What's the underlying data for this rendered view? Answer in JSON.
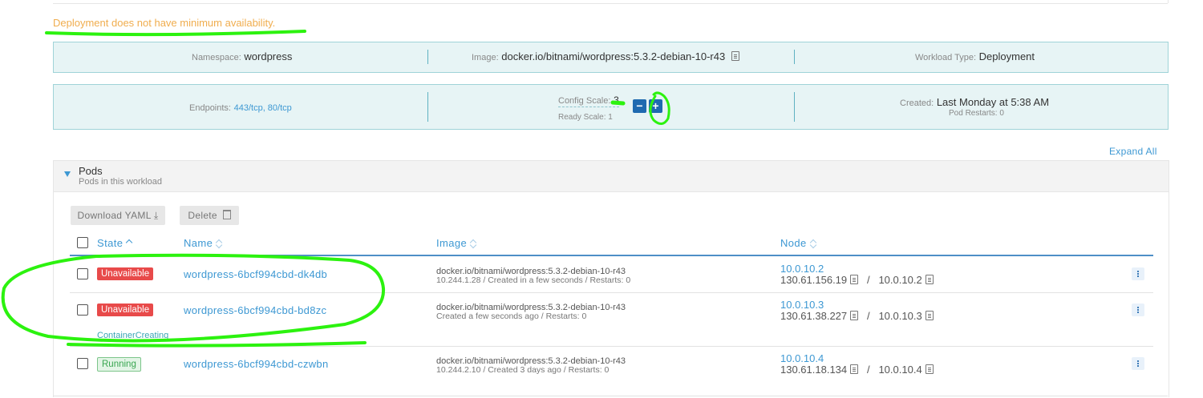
{
  "warning": "Deployment does not have minimum availability.",
  "info_row1": {
    "namespace_label": "Namespace:",
    "namespace_value": "wordpress",
    "image_label": "Image:",
    "image_value": "docker.io/bitnami/wordpress:5.3.2-debian-10-r43",
    "workload_type_label": "Workload Type:",
    "workload_type_value": "Deployment"
  },
  "info_row2": {
    "endpoints_label": "Endpoints:",
    "endpoints_value": "443/tcp, 80/tcp",
    "config_scale_label": "Config Scale:",
    "config_scale_value": "3",
    "ready_scale": "Ready Scale: 1",
    "decrement_label": "−",
    "increment_label": "+",
    "created_label": "Created:",
    "created_value": "Last Monday at 5:38 AM",
    "pod_restarts": "Pod Restarts: 0"
  },
  "expand_all": "Expand All",
  "pods": {
    "title": "Pods",
    "subtitle": "Pods in this workload",
    "download_yaml": "Download YAML",
    "delete": "Delete",
    "columns": {
      "state": "State",
      "name": "Name",
      "image": "Image",
      "node": "Node"
    },
    "rows": [
      {
        "state": "Unavailable",
        "name": "wordpress-6bcf994cbd-dk4db",
        "image": "docker.io/bitnami/wordpress:5.3.2-debian-10-r43",
        "image_detail": "10.244.1.28 / Created in a few seconds / Restarts: 0",
        "node_name": "10.0.10.2",
        "node_ip": "130.61.156.19",
        "node_sep": "/",
        "node_internal": "10.0.10.2",
        "substate": ""
      },
      {
        "state": "Unavailable",
        "name": "wordpress-6bcf994cbd-bd8zc",
        "image": "docker.io/bitnami/wordpress:5.3.2-debian-10-r43",
        "image_detail": "Created a few seconds ago / Restarts: 0",
        "node_name": "10.0.10.3",
        "node_ip": "130.61.38.227",
        "node_sep": "/",
        "node_internal": "10.0.10.3",
        "substate": "ContainerCreating"
      },
      {
        "state": "Running",
        "name": "wordpress-6bcf994cbd-czwbn",
        "image": "docker.io/bitnami/wordpress:5.3.2-debian-10-r43",
        "image_detail": "10.244.2.10 / Created 3 days ago / Restarts: 0",
        "node_name": "10.0.10.4",
        "node_ip": "130.61.18.134",
        "node_sep": "/",
        "node_internal": "10.0.10.4",
        "substate": ""
      }
    ]
  },
  "colors": {
    "accent": "#3d98d3",
    "warning": "#f0ad4e",
    "danger": "#e84a4a",
    "success": "#3aa651",
    "annotation": "#2cf20f"
  }
}
